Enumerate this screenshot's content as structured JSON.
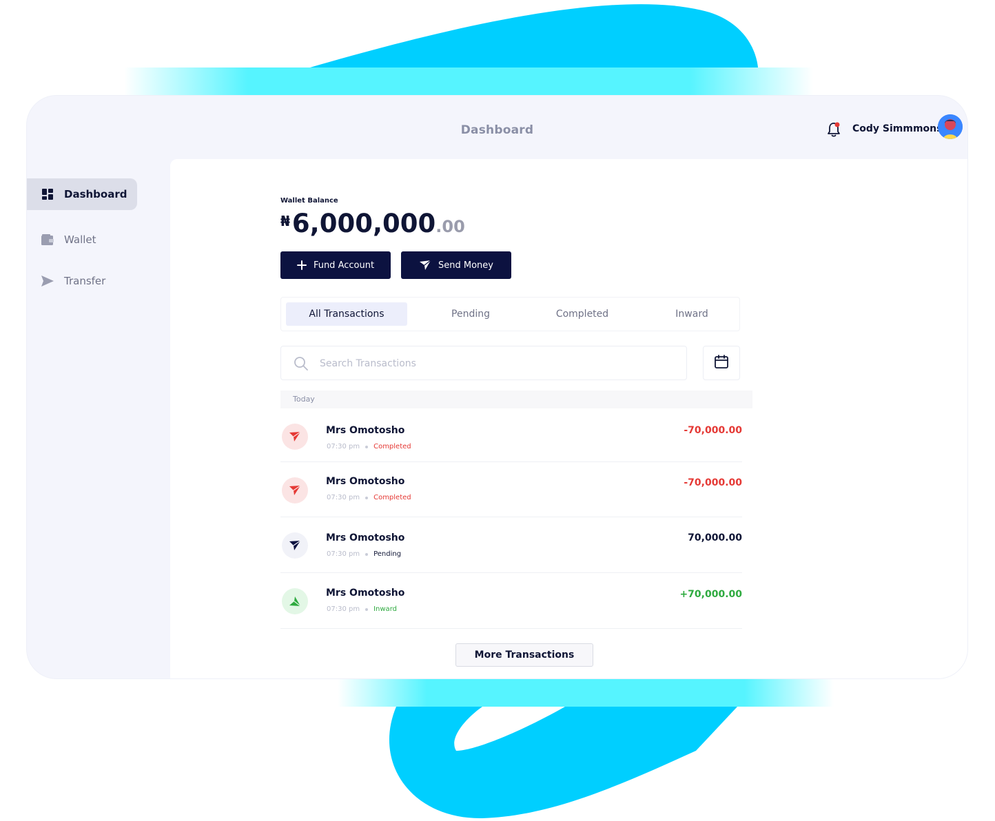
{
  "header": {
    "title": "Dashboard",
    "user_name": "Cody Simmmons"
  },
  "sidebar": {
    "items": [
      {
        "label": "Dashboard",
        "icon": "grid-icon",
        "active": true
      },
      {
        "label": "Wallet",
        "icon": "wallet-icon",
        "active": false
      },
      {
        "label": "Transfer",
        "icon": "send-icon",
        "active": false
      }
    ]
  },
  "wallet": {
    "label": "Wallet Balance",
    "currency": "₦",
    "amount_whole": "6,000,000",
    "amount_decimal": ".00"
  },
  "actions": {
    "fund_label": "Fund Account",
    "send_label": "Send Money"
  },
  "tabs": [
    {
      "label": "All Transactions",
      "active": true
    },
    {
      "label": "Pending",
      "active": false
    },
    {
      "label": "Completed",
      "active": false
    },
    {
      "label": "Inward",
      "active": false
    }
  ],
  "search": {
    "placeholder": "Search Transactions"
  },
  "transactions": {
    "group_label": "Today",
    "items": [
      {
        "name": "Mrs Omotosho",
        "time": "07:30 pm",
        "status": "Completed",
        "amount": "-70,000.00",
        "kind": "outgoing"
      },
      {
        "name": "Mrs Omotosho",
        "time": "07:30 pm",
        "status": "Completed",
        "amount": "-70,000.00",
        "kind": "outgoing"
      },
      {
        "name": "Mrs Omotosho",
        "time": "07:30 pm",
        "status": "Pending",
        "amount": "70,000.00",
        "kind": "pending"
      },
      {
        "name": "Mrs Omotosho",
        "time": "07:30 pm",
        "status": "Inward",
        "amount": "+70,000.00",
        "kind": "inward"
      }
    ],
    "more_label": "More Transactions"
  },
  "colors": {
    "brand_dark": "#0c1240",
    "accent_cyan": "#00cfff",
    "negative": "#e53935",
    "positive": "#2eaa3f",
    "pending": "#0f1535"
  }
}
